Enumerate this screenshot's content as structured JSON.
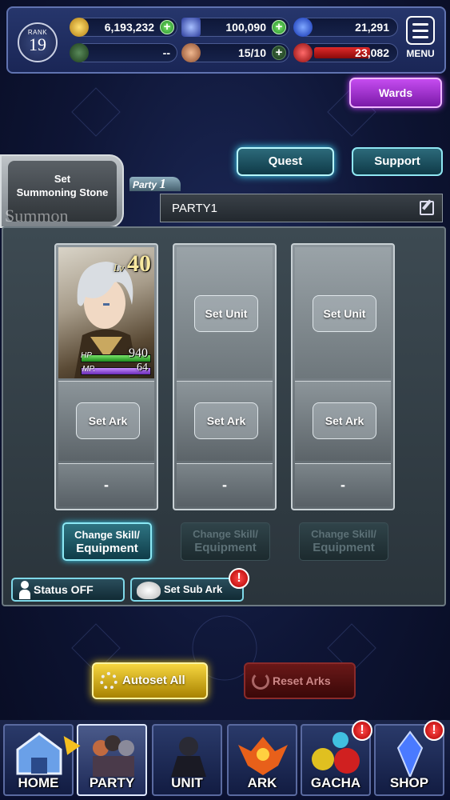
{
  "topbar": {
    "rank_label": "RANK",
    "rank_value": "19",
    "gil": "6,193,232",
    "blue_crystals": "100,090",
    "orbs": "21,291",
    "green_resource": "--",
    "stamina": "15/10",
    "red_resource": "23,082",
    "menu_label": "MENU"
  },
  "buttons": {
    "wards": "Wards",
    "quest": "Quest",
    "support": "Support"
  },
  "summon": {
    "set_line1": "Set",
    "set_line2": "Summoning Stone",
    "watermark": "Summon"
  },
  "party": {
    "tag_label": "Party",
    "tag_number": "1",
    "name": "PARTY1"
  },
  "slots": [
    {
      "unit": {
        "level_label": "Lv",
        "level": "40",
        "hp_label": "HP",
        "hp": "940",
        "mp_label": "MP.",
        "mp": "64"
      },
      "ark_label": "Set Ark",
      "extra": "-",
      "change_line1": "Change Skill/",
      "change_line2": "Equipment"
    },
    {
      "unit_label": "Set Unit",
      "ark_label": "Set Ark",
      "extra": "-",
      "change_line1": "Change Skill/",
      "change_line2": "Equipment"
    },
    {
      "unit_label": "Set Unit",
      "ark_label": "Set Ark",
      "extra": "-",
      "change_line1": "Change Skill/",
      "change_line2": "Equipment"
    }
  ],
  "controls": {
    "status": "Status OFF",
    "sub_ark": "Set Sub Ark",
    "sub_ark_badge": "!",
    "autoset": "Autoset All",
    "reset": "Reset Arks"
  },
  "nav": [
    {
      "label": "HOME"
    },
    {
      "label": "PARTY"
    },
    {
      "label": "UNIT"
    },
    {
      "label": "ARK"
    },
    {
      "label": "GACHA",
      "badge": "!"
    },
    {
      "label": "SHOP",
      "badge": "!"
    }
  ],
  "colors": {
    "accent_cyan": "#8fe6f2",
    "wards_purple": "#c54cf0",
    "autoset_gold": "#f6d640",
    "reset_red": "#6a1818"
  }
}
